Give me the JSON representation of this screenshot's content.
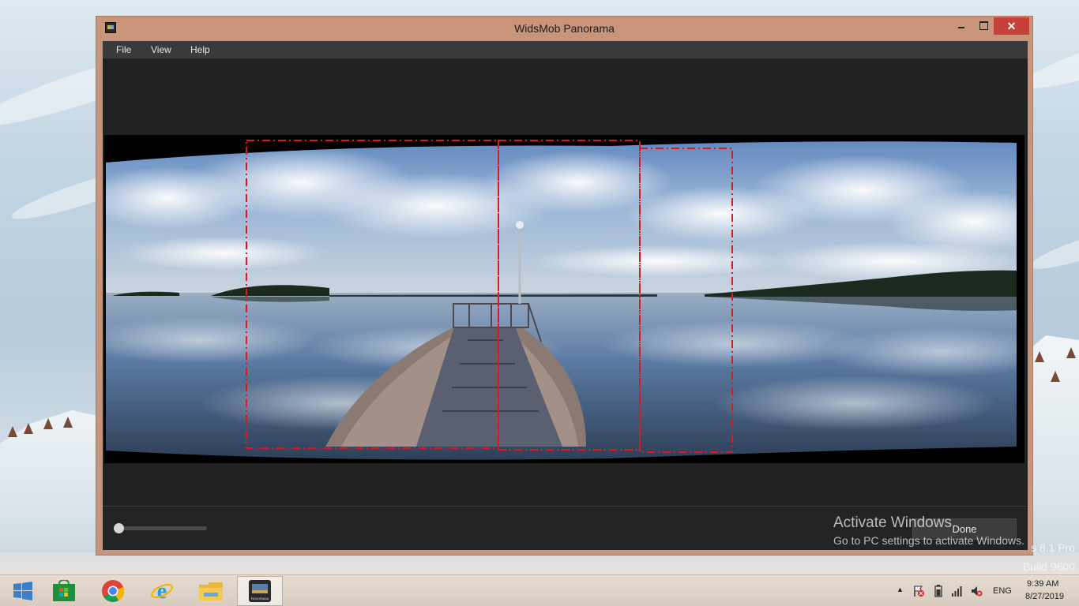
{
  "window": {
    "title": "WidsMob Panorama",
    "menu": [
      "File",
      "View",
      "Help"
    ],
    "close_glyph": "✕",
    "done_label": "Done",
    "zoom_slider_value": 0.0
  },
  "watermark": {
    "line1": "Activate Windows",
    "line2": "Go to PC settings to activate Windows.",
    "edition": "s 8.1 Pro",
    "build": "Build 9600"
  },
  "taskbar": {
    "pinned": [
      "windows-start-icon",
      "windows-store-icon",
      "chrome-icon",
      "internet-explorer-icon",
      "file-explorer-icon",
      "widsmob-panorama-icon"
    ],
    "app_icon_label": "PANORAMA",
    "language": "ENG",
    "time": "9:39 AM",
    "date": "8/27/2019"
  },
  "colors": {
    "title_accent": "#c9957a",
    "close_button": "#c7413b",
    "dark_client": "#232323",
    "crop_guides": "#e01818"
  }
}
